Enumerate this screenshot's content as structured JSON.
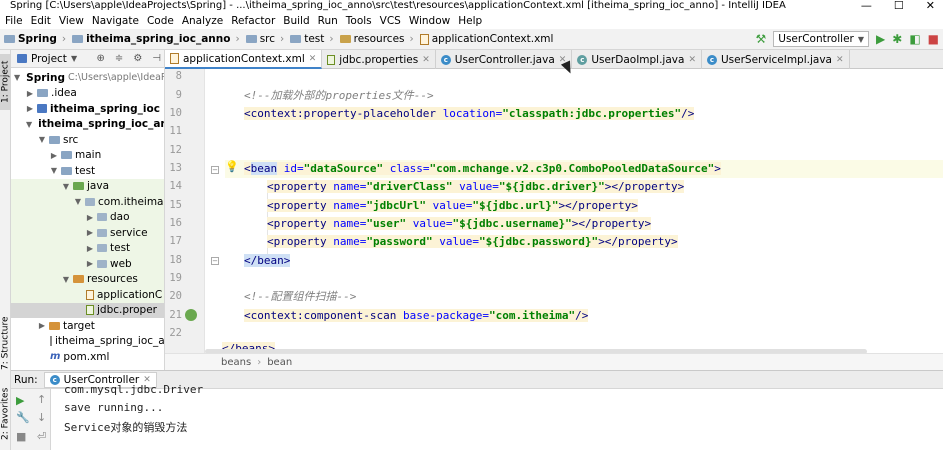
{
  "window": {
    "title": "Spring [C:\\Users\\apple\\IdeaProjects\\Spring] - ...\\itheima_spring_ioc_anno\\src\\test\\resources\\applicationContext.xml [itheima_spring_ioc_anno] - IntelliJ IDEA",
    "min_glyph": "—",
    "max_glyph": "☐",
    "close_glyph": "✕"
  },
  "menu": [
    "File",
    "Edit",
    "View",
    "Navigate",
    "Code",
    "Analyze",
    "Refactor",
    "Build",
    "Run",
    "Tools",
    "VCS",
    "Window",
    "Help"
  ],
  "breadcrumb": [
    "Spring",
    "itheima_spring_ioc_anno",
    "src",
    "test",
    "resources",
    "applicationContext.xml"
  ],
  "run_config": {
    "label": "UserController"
  },
  "left_strip": {
    "project_tab": "1: Project",
    "structure_tab": "7: Structure",
    "favorites_tab": "2: Favorites"
  },
  "project_panel": {
    "title": "Project",
    "tree": [
      {
        "label": "Spring",
        "sub": "C:\\Users\\apple\\IdeaP",
        "bold": true
      },
      {
        "label": ".idea"
      },
      {
        "label": "itheima_spring_ioc",
        "bold": true
      },
      {
        "label": "itheima_spring_ioc_anno",
        "bold": true
      },
      {
        "label": "src"
      },
      {
        "label": "main"
      },
      {
        "label": "test"
      },
      {
        "label": "java"
      },
      {
        "label": "com.itheima"
      },
      {
        "label": "dao"
      },
      {
        "label": "service"
      },
      {
        "label": "test"
      },
      {
        "label": "web"
      },
      {
        "label": "resources"
      },
      {
        "label": "applicationC"
      },
      {
        "label": "jdbc.proper"
      },
      {
        "label": "target"
      },
      {
        "label": "itheima_spring_ioc_ann"
      },
      {
        "label": "pom.xml"
      }
    ]
  },
  "tabs": [
    {
      "label": "applicationContext.xml",
      "active": true
    },
    {
      "label": "jdbc.properties"
    },
    {
      "label": "UserController.java"
    },
    {
      "label": "UserDaoImpl.java"
    },
    {
      "label": "UserServiceImpl.java"
    }
  ],
  "line_numbers": [
    "8",
    "9",
    "10",
    "11",
    "12",
    "13",
    "14",
    "15",
    "16",
    "17",
    "18",
    "19",
    "20",
    "21",
    "22"
  ],
  "code": {
    "l9_open": "<!--加载外部的",
    "l9_em": "properties",
    "l9_close": "文件-->",
    "l10_tag": "<context:property-placeholder",
    "l10_attr": "location=",
    "l10_val": "\"classpath:jdbc.properties\"",
    "l10_end": "/>",
    "l13_lt": "<",
    "l13_name": "bean",
    "l13_attr1": "id=",
    "l13_val1": "\"dataSource\"",
    "l13_attr2": "class=",
    "l13_val2": "\"com.mchange.v2.c3p0.ComboPooledDataSource\"",
    "l13_end": ">",
    "props": [
      {
        "name": "\"driverClass\"",
        "value": "\"${jdbc.driver}\""
      },
      {
        "name": "\"jdbcUrl\"",
        "value": "\"${jdbc.url}\""
      },
      {
        "name": "\"user\"",
        "value": "\"${jdbc.username}\""
      },
      {
        "name": "\"password\"",
        "value": "\"${jdbc.password}\""
      }
    ],
    "prop_open": "<property",
    "prop_name_attr": "name=",
    "prop_value_attr": "value=",
    "prop_close": "></property>",
    "l18": "</bean>",
    "l20": "<!--配置组件扫描-->",
    "l21_tag": "<context:component-scan",
    "l21_attr": "base-package=",
    "l21_val": "\"com.itheima\"",
    "l21_end": "/>",
    "l23": "</beans>"
  },
  "editor_breadcrumb": [
    "beans",
    "bean"
  ],
  "run_panel": {
    "label": "Run:",
    "tab": "UserController",
    "console": [
      "com.mysql.jdbc.Driver",
      "save running...",
      "Service对象的销毁方法"
    ]
  }
}
